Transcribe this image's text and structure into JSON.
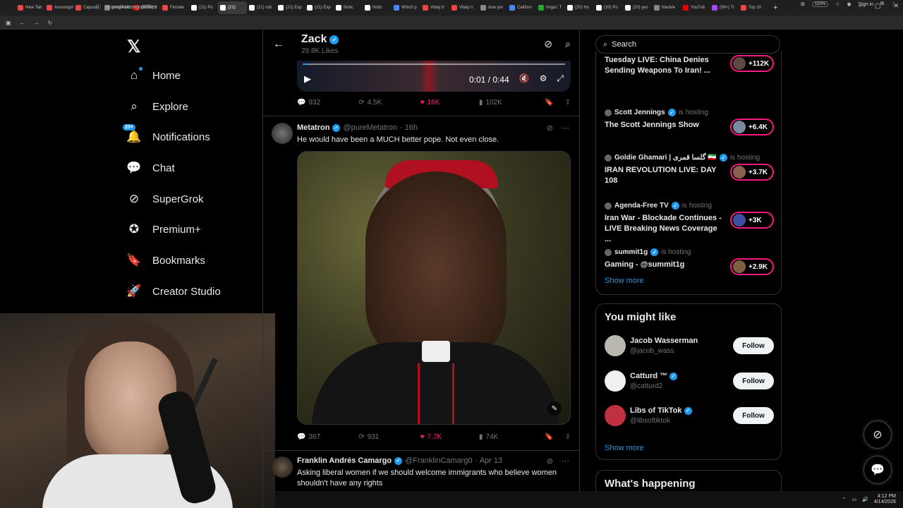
{
  "browser": {
    "tabs": [
      {
        "label": "New Tab",
        "color": "#e44"
      },
      {
        "label": "Asmongold",
        "color": "#e44"
      },
      {
        "label": "Capcom",
        "color": "#e44"
      },
      {
        "label": "pragmatic",
        "color": "#888"
      },
      {
        "label": "(3950) Y",
        "color": "#e00"
      },
      {
        "label": "Female",
        "color": "#e44"
      },
      {
        "label": "(21) Po",
        "color": "#fff"
      },
      {
        "label": "(21)",
        "color": "#fff"
      },
      {
        "label": "(21) rob",
        "color": "#fff"
      },
      {
        "label": "(21) Exp",
        "color": "#fff"
      },
      {
        "label": "(21) Exp",
        "color": "#fff"
      },
      {
        "label": "Notic",
        "color": "#fff"
      },
      {
        "label": "Notic",
        "color": "#fff"
      },
      {
        "label": "Which p",
        "color": "#48f"
      },
      {
        "label": "Vitaly b",
        "color": "#e44"
      },
      {
        "label": "Vitaly n",
        "color": "#e44"
      },
      {
        "label": "dow jon",
        "color": "#888"
      },
      {
        "label": "Californ",
        "color": "#48f"
      },
      {
        "label": "Imgur: T",
        "color": "#2a2"
      },
      {
        "label": "(20) Ho",
        "color": "#fff"
      },
      {
        "label": "(20) Po",
        "color": "#fff"
      },
      {
        "label": "(20) yes",
        "color": "#fff"
      },
      {
        "label": "blackfe",
        "color": "#888"
      },
      {
        "label": "YouTub",
        "color": "#e00"
      },
      {
        "label": "(99+) Ti",
        "color": "#a4f"
      },
      {
        "label": "Top 10",
        "color": "#e44"
      }
    ],
    "active_tab_index": 7,
    "url": "x.com/Asmongold/likes",
    "zoom": "150%",
    "sign_in": "Sign in"
  },
  "nav": {
    "items": [
      {
        "label": "Home",
        "icon": "home-icon",
        "glyph": "⌂"
      },
      {
        "label": "Explore",
        "icon": "search-icon",
        "glyph": "⌕"
      },
      {
        "label": "Notifications",
        "icon": "bell-icon",
        "glyph": "🔔"
      },
      {
        "label": "Chat",
        "icon": "chat-icon",
        "glyph": "💬"
      },
      {
        "label": "SuperGrok",
        "icon": "grok-icon",
        "glyph": "⊘"
      },
      {
        "label": "Premium+",
        "icon": "premium-icon",
        "glyph": "✪"
      },
      {
        "label": "Bookmarks",
        "icon": "bookmark-icon",
        "glyph": "🔖"
      },
      {
        "label": "Creator Studio",
        "icon": "rocket-icon",
        "glyph": "🚀"
      }
    ],
    "notifications_badge": "20+"
  },
  "profile": {
    "name": "Zack",
    "likes_count": "29.8K Likes"
  },
  "video": {
    "time": "0:01 / 0:44"
  },
  "tweet1_stats": {
    "replies": "932",
    "reposts": "4.5K",
    "likes": "16K",
    "views": "102K"
  },
  "tweet2": {
    "name": "Metatron",
    "handle": "@pureMetatron",
    "time": "· 16h",
    "text": "He would have been a MUCH better pope. Not even close.",
    "replies": "367",
    "reposts": "931",
    "likes": "7.7K",
    "views": "74K"
  },
  "tweet3": {
    "name": "Franklin Andrés Camargo",
    "handle": "@FranklinCamarg0",
    "time": "· Apr 13",
    "text": "Asking liberal women if we should welcome immigrants who believe women shouldn't have any rights"
  },
  "search": {
    "placeholder": "Search"
  },
  "live": {
    "items": [
      {
        "host": "",
        "status": "",
        "title": "Tuesday LIVE: China Denies Sending Weapons To Iran! ...",
        "count": "+112K"
      },
      {
        "host": "Scott Jennings",
        "status": "is hosting",
        "title": "The Scott Jennings Show",
        "count": "+6.4K"
      },
      {
        "host": "Goldie Ghamari | گلسا قمری 🇮🇷",
        "status": "is hosting",
        "title": "IRAN REVOLUTION LIVE: DAY 108",
        "count": "+3.7K"
      },
      {
        "host": "Agenda-Free TV",
        "status": "is hosting",
        "title": "Iran War - Blockade Continues - LIVE Breaking News Coverage ...",
        "count": "+3K"
      },
      {
        "host": "summit1g",
        "status": "is hosting",
        "title": "Gaming - @summit1g",
        "count": "+2.9K"
      }
    ],
    "show_more": "Show more"
  },
  "might_like": {
    "title": "You might like",
    "users": [
      {
        "name": "Jacob Wasserman",
        "handle": "@jacob_wass",
        "verified": false
      },
      {
        "name": "Catturd ™",
        "handle": "@catturd2",
        "verified": true
      },
      {
        "name": "Libs of TikTok",
        "handle": "@libsoftiktok",
        "verified": true
      }
    ],
    "follow_label": "Follow",
    "show_more": "Show more"
  },
  "whats_happening": {
    "title": "What's happening"
  },
  "taskbar": {
    "time": "4:12 PM",
    "date": "4/14/2026"
  },
  "colors": {
    "accent": "#1d9bf0",
    "like": "#f91880",
    "background": "#000000"
  }
}
